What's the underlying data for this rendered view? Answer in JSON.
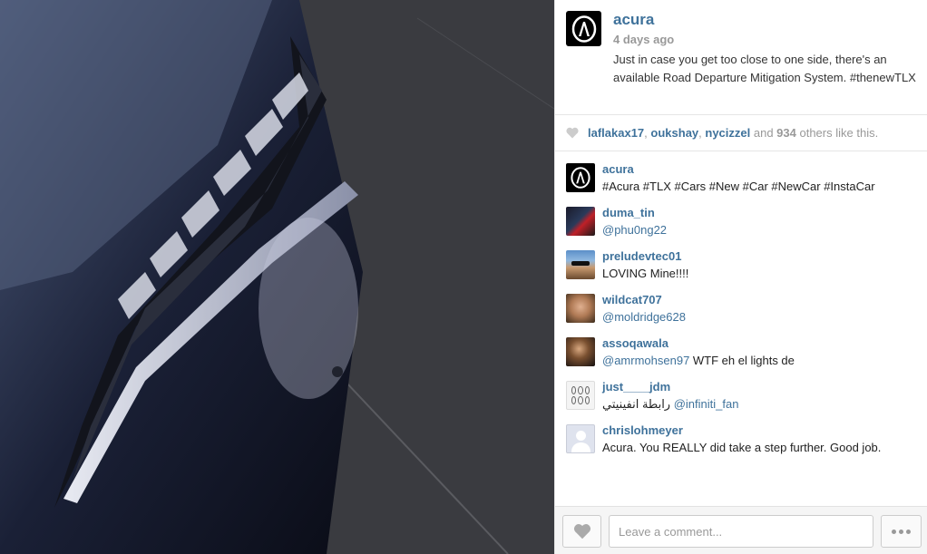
{
  "post": {
    "owner": "acura",
    "time_ago": "4 days ago",
    "caption": "Just in case you get too close to one side, there's an available Road Departure Mitigation System. #thenewTLX"
  },
  "likes": {
    "users": [
      "laflakax17",
      "oukshay",
      "nycizzel"
    ],
    "separator": ", ",
    "and_text": " and ",
    "count": "934",
    "suffix": " others like this."
  },
  "comments": [
    {
      "user": "acura",
      "text": "#Acura #TLX #Cars #New #Car #NewCar #InstaCar",
      "avatar": "acura-logo-icon"
    },
    {
      "user": "duma_tin",
      "mention": "@phu0ng22",
      "text": "",
      "avatar": "red-photo"
    },
    {
      "user": "preludevtec01",
      "text": "LOVING Mine!!!!",
      "avatar": "sunglasses-photo"
    },
    {
      "user": "wildcat707",
      "mention": "@moldridge628",
      "text": "",
      "avatar": "face-photo"
    },
    {
      "user": "assoqawala",
      "mention": "@amrmohsen97",
      "text": " WTF eh el lights de",
      "avatar": "dark-photo"
    },
    {
      "user": "just____jdm",
      "prefix": "رابطة انفينيتي ",
      "mention": "@infiniti_fan",
      "text": "",
      "avatar": "logo-grid-photo"
    },
    {
      "user": "chrislohmeyer",
      "text": "Acura. You REALLY did take a step further. Good job.",
      "avatar": "default-avatar"
    }
  ],
  "footer": {
    "comment_placeholder": "Leave a comment..."
  },
  "colors": {
    "link": "#3f729b",
    "muted": "#999999"
  }
}
